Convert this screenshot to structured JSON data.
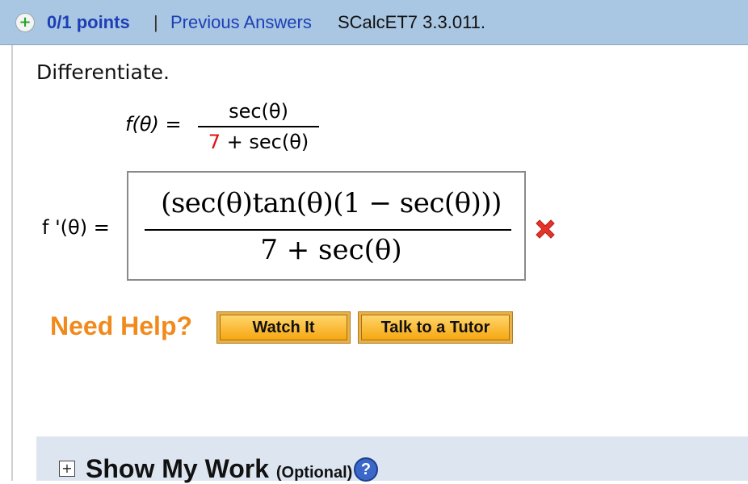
{
  "header": {
    "plus_icon": "plus-circle-icon",
    "points": "0/1 points",
    "separator": "|",
    "previous_answers": "Previous Answers",
    "problem_code": "SCalcET7 3.3.011."
  },
  "question": {
    "instruction": "Differentiate.",
    "function_name": "f",
    "variable": "θ",
    "lhs": "f(θ)  =",
    "numerator": "sec(θ)",
    "denominator_constant": "7",
    "denominator_rest": " + sec(θ)"
  },
  "answer": {
    "lhs": "f '(θ)  =",
    "numerator": "(sec(θ)tan(θ)(1 − sec(θ)))",
    "denominator": "7 + sec(θ)",
    "status": "incorrect",
    "status_icon": "red-x-icon"
  },
  "help": {
    "label": "Need Help?",
    "watch_button": "Watch It",
    "tutor_button": "Talk to a Tutor"
  },
  "show_my_work": {
    "title": "Show My Work",
    "optional": "(Optional)",
    "expand_icon": "plus-box-icon",
    "help_icon": "question-icon"
  },
  "colors": {
    "header_bg": "#a9c6e2",
    "link_blue": "#1c3fb5",
    "need_help_orange": "#f08a1c",
    "error_red": "#e01010"
  }
}
